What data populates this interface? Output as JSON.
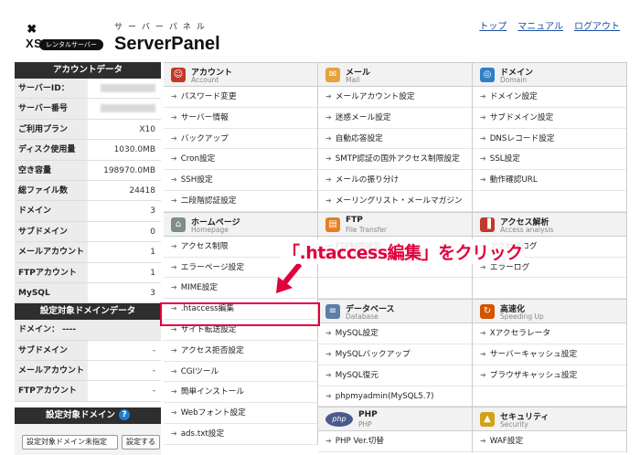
{
  "header": {
    "logo_text": "XSERVER",
    "logo_badge": "レンタルサーバー",
    "panel_sub": "サーバーパネル",
    "panel_title": "ServerPanel",
    "nav": [
      "トップ",
      "マニュアル",
      "ログアウト"
    ]
  },
  "sidebar": {
    "account_title": "アカウントデータ",
    "account_rows": [
      {
        "k": "サーバーID：",
        "v": ""
      },
      {
        "k": "サーバー番号",
        "v": ""
      },
      {
        "k": "ご利用プラン",
        "v": "X10"
      },
      {
        "k": "ディスク使用量",
        "v": "1030.0MB"
      },
      {
        "k": "空き容量",
        "v": "198970.0MB"
      },
      {
        "k": "総ファイル数",
        "v": "24418"
      },
      {
        "k": "ドメイン",
        "v": "3"
      },
      {
        "k": "サブドメイン",
        "v": "0"
      },
      {
        "k": "メールアカウント",
        "v": "1"
      },
      {
        "k": "FTPアカウント",
        "v": "1"
      },
      {
        "k": "MySQL",
        "v": "3"
      }
    ],
    "domain_title": "設定対象ドメインデータ",
    "domain_label": "ドメイン： ----",
    "domain_rows": [
      {
        "k": "サブドメイン",
        "v": "-"
      },
      {
        "k": "メールアカウント",
        "v": "-"
      },
      {
        "k": "FTPアカウント",
        "v": "-"
      }
    ],
    "select_title": "設定対象ドメイン",
    "help": "?",
    "select_value": "設定対象ドメイン未指定",
    "select_button": "設定する"
  },
  "columns": [
    {
      "sections": [
        {
          "title": "アカウント",
          "en": "Account",
          "color": "#c0392b",
          "icon": "user-icon",
          "glyph": "☺",
          "items": [
            "パスワード変更",
            "サーバー情報",
            "バックアップ",
            "Cron設定",
            "SSH設定",
            "二段階認証設定"
          ],
          "blank": 0
        },
        {
          "title": "ホームページ",
          "en": "Homepage",
          "color": "#7f8c8d",
          "icon": "home-icon",
          "glyph": "⌂",
          "items": [
            "アクセス制限",
            "エラーページ設定",
            "MIME設定",
            ".htaccess編集",
            "サイト転送設定",
            "アクセス拒否設定",
            "CGIツール",
            "簡単インストール",
            "Webフォント設定",
            "ads.txt設定"
          ],
          "blank": 0
        }
      ]
    },
    {
      "sections": [
        {
          "title": "メール",
          "en": "Mail",
          "color": "#e6a23c",
          "icon": "mail-icon",
          "glyph": "✉",
          "items": [
            "メールアカウント設定",
            "迷惑メール設定",
            "自動応答設定",
            "SMTP認証の国外アクセス制限設定",
            "メールの振り分け",
            "メーリングリスト・メールマガジン"
          ],
          "blank": 0
        },
        {
          "title": "FTP",
          "en": "File Transfer",
          "color": "#e67e22",
          "icon": "folder-icon",
          "glyph": "▤",
          "items": [
            "FTP制限設定"
          ],
          "blank": 2
        },
        {
          "title": "データベース",
          "en": "Database",
          "color": "#5b7fa6",
          "icon": "database-icon",
          "glyph": "≡",
          "items": [
            "MySQL設定",
            "MySQLバックアップ",
            "MySQL復元",
            "phpmyadmin(MySQL5.7)"
          ],
          "blank": 0
        },
        {
          "title": "PHP",
          "en": "PHP",
          "color": "#4a5a8c",
          "icon": "php-icon",
          "glyph": "php",
          "items": [
            "PHP Ver.切替"
          ],
          "blank": 0
        }
      ]
    },
    {
      "sections": [
        {
          "title": "ドメイン",
          "en": "Domain",
          "color": "#2f80c6",
          "icon": "globe-icon",
          "glyph": "◎",
          "items": [
            "ドメイン設定",
            "サブドメイン設定",
            "DNSレコード設定",
            "SSL設定",
            "動作確認URL"
          ],
          "blank": 1
        },
        {
          "title": "アクセス解析",
          "en": "Access analysis",
          "color": "#c0392b",
          "icon": "analytics-icon",
          "glyph": "▐",
          "items": [
            "アクセスログ",
            "エラーログ"
          ],
          "blank": 1
        },
        {
          "title": "高速化",
          "en": "Speeding Up",
          "color": "#d35400",
          "icon": "speed-icon",
          "glyph": "↻",
          "items": [
            "Xアクセラレータ",
            "サーバーキャッシュ設定",
            "ブラウザキャッシュ設定"
          ],
          "blank": 1
        },
        {
          "title": "セキュリティ",
          "en": "Security",
          "color": "#d4a017",
          "icon": "shield-icon",
          "glyph": "▲",
          "items": [
            "WAF設定"
          ],
          "blank": 0
        }
      ]
    }
  ],
  "callout": "「.htaccess編集」をクリック",
  "accent": "#e0003c"
}
